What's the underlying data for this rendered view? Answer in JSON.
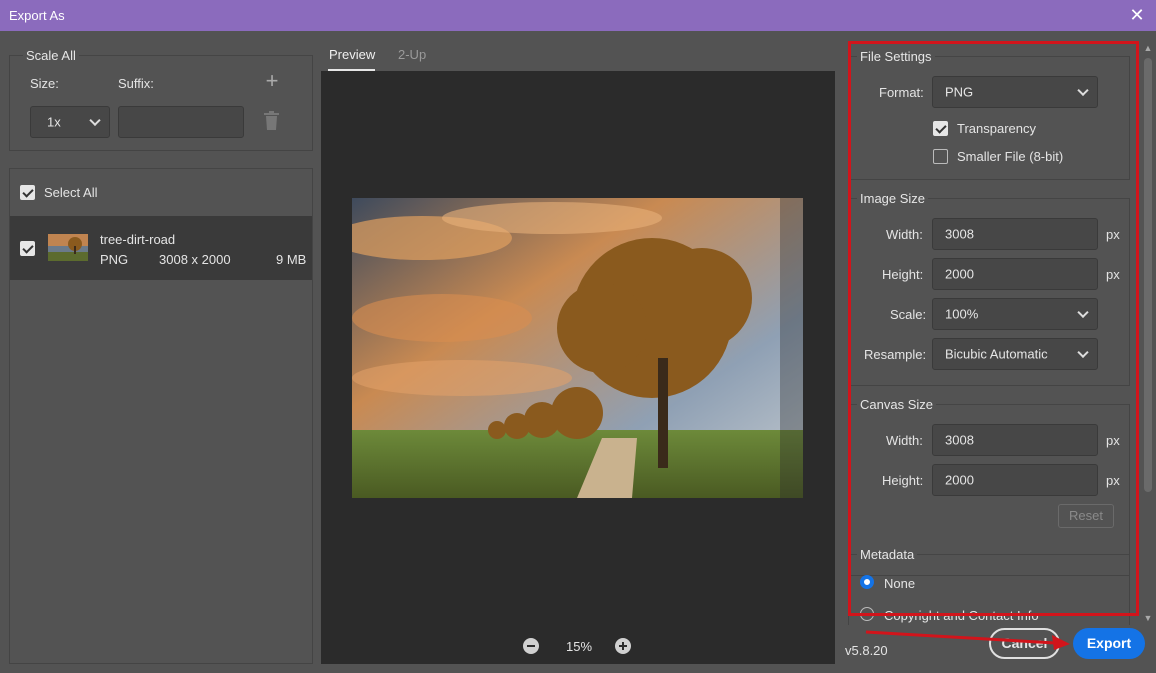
{
  "window": {
    "title": "Export As",
    "close_glyph": "✕"
  },
  "scale": {
    "title": "Scale All",
    "size_label": "Size:",
    "suffix_label": "Suffix:",
    "size_value": "1x",
    "suffix_value": "",
    "add_glyph": "+"
  },
  "assets": {
    "select_all_label": "Select All",
    "items": [
      {
        "name": "tree-dirt-road",
        "format": "PNG",
        "dimensions": "3008 x 2000",
        "size": "9 MB"
      }
    ]
  },
  "preview": {
    "tabs": [
      {
        "label": "Preview",
        "active": true
      },
      {
        "label": "2-Up",
        "active": false
      }
    ],
    "zoom": "15%"
  },
  "file_settings": {
    "title": "File Settings",
    "format_label": "Format:",
    "format_value": "PNG",
    "transparency_label": "Transparency",
    "transparency_checked": true,
    "smaller_file_label": "Smaller File (8-bit)",
    "smaller_file_checked": false
  },
  "image_size": {
    "title": "Image Size",
    "width_label": "Width:",
    "width_value": "3008",
    "height_label": "Height:",
    "height_value": "2000",
    "unit": "px",
    "scale_label": "Scale:",
    "scale_value": "100%",
    "resample_label": "Resample:",
    "resample_value": "Bicubic Automatic"
  },
  "canvas_size": {
    "title": "Canvas Size",
    "width_label": "Width:",
    "width_value": "3008",
    "height_label": "Height:",
    "height_value": "2000",
    "unit": "px",
    "reset_label": "Reset"
  },
  "metadata": {
    "title": "Metadata",
    "options": [
      {
        "label": "None",
        "selected": true
      },
      {
        "label": "Copyright and Contact Info",
        "selected": false
      }
    ]
  },
  "footer": {
    "version": "v5.8.20",
    "cancel_label": "Cancel",
    "export_label": "Export"
  },
  "colors": {
    "accent": "#1473e6",
    "annotation_red": "#d2141b",
    "titlebar": "#8b6bbd"
  }
}
